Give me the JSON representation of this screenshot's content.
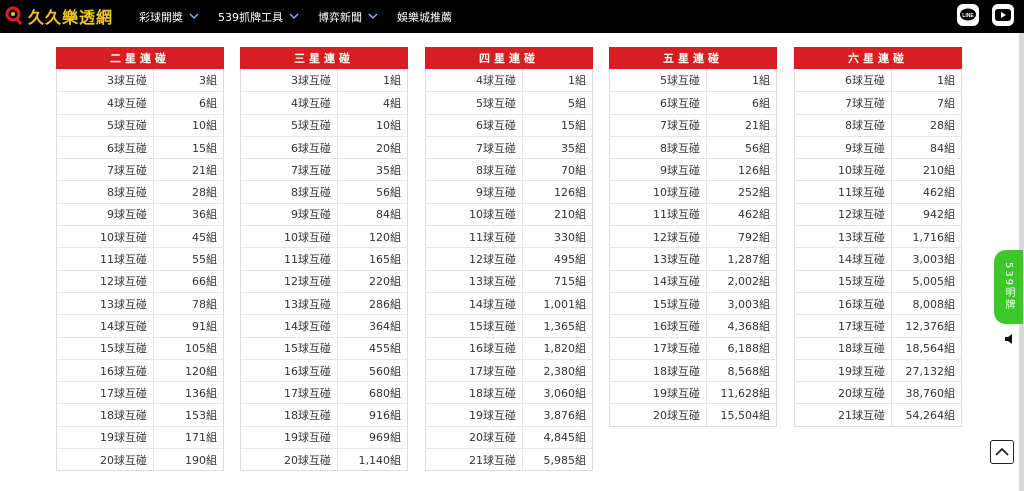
{
  "brand": {
    "name": "久久樂透網",
    "accent": "#f0c419"
  },
  "nav": [
    {
      "label": "彩球開獎",
      "has_dropdown": true
    },
    {
      "label": "539抓牌工具",
      "has_dropdown": true
    },
    {
      "label": "博弈新聞",
      "has_dropdown": true
    },
    {
      "label": "娛樂城推薦",
      "has_dropdown": false
    }
  ],
  "top_icons": [
    "line-icon",
    "youtube-icon"
  ],
  "tables": [
    {
      "title": "二星連碰",
      "rows": [
        [
          "3球互碰",
          "3組"
        ],
        [
          "4球互碰",
          "6組"
        ],
        [
          "5球互碰",
          "10組"
        ],
        [
          "6球互碰",
          "15組"
        ],
        [
          "7球互碰",
          "21組"
        ],
        [
          "8球互碰",
          "28組"
        ],
        [
          "9球互碰",
          "36組"
        ],
        [
          "10球互碰",
          "45組"
        ],
        [
          "11球互碰",
          "55組"
        ],
        [
          "12球互碰",
          "66組"
        ],
        [
          "13球互碰",
          "78組"
        ],
        [
          "14球互碰",
          "91組"
        ],
        [
          "15球互碰",
          "105組"
        ],
        [
          "16球互碰",
          "120組"
        ],
        [
          "17球互碰",
          "136組"
        ],
        [
          "18球互碰",
          "153組"
        ],
        [
          "19球互碰",
          "171組"
        ],
        [
          "20球互碰",
          "190組"
        ]
      ]
    },
    {
      "title": "三星連碰",
      "rows": [
        [
          "3球互碰",
          "1組"
        ],
        [
          "4球互碰",
          "4組"
        ],
        [
          "5球互碰",
          "10組"
        ],
        [
          "6球互碰",
          "20組"
        ],
        [
          "7球互碰",
          "35組"
        ],
        [
          "8球互碰",
          "56組"
        ],
        [
          "9球互碰",
          "84組"
        ],
        [
          "10球互碰",
          "120組"
        ],
        [
          "11球互碰",
          "165組"
        ],
        [
          "12球互碰",
          "220組"
        ],
        [
          "13球互碰",
          "286組"
        ],
        [
          "14球互碰",
          "364組"
        ],
        [
          "15球互碰",
          "455組"
        ],
        [
          "16球互碰",
          "560組"
        ],
        [
          "17球互碰",
          "680組"
        ],
        [
          "18球互碰",
          "916組"
        ],
        [
          "19球互碰",
          "969組"
        ],
        [
          "20球互碰",
          "1,140組"
        ]
      ]
    },
    {
      "title": "四星連碰",
      "rows": [
        [
          "4球互碰",
          "1組"
        ],
        [
          "5球互碰",
          "5組"
        ],
        [
          "6球互碰",
          "15組"
        ],
        [
          "7球互碰",
          "35組"
        ],
        [
          "8球互碰",
          "70組"
        ],
        [
          "9球互碰",
          "126組"
        ],
        [
          "10球互碰",
          "210組"
        ],
        [
          "11球互碰",
          "330組"
        ],
        [
          "12球互碰",
          "495組"
        ],
        [
          "13球互碰",
          "715組"
        ],
        [
          "14球互碰",
          "1,001組"
        ],
        [
          "15球互碰",
          "1,365組"
        ],
        [
          "16球互碰",
          "1,820組"
        ],
        [
          "17球互碰",
          "2,380組"
        ],
        [
          "18球互碰",
          "3,060組"
        ],
        [
          "19球互碰",
          "3,876組"
        ],
        [
          "20球互碰",
          "4,845組"
        ],
        [
          "21球互碰",
          "5,985組"
        ]
      ]
    },
    {
      "title": "五星連碰",
      "rows": [
        [
          "5球互碰",
          "1組"
        ],
        [
          "6球互碰",
          "6組"
        ],
        [
          "7球互碰",
          "21組"
        ],
        [
          "8球互碰",
          "56組"
        ],
        [
          "9球互碰",
          "126組"
        ],
        [
          "10球互碰",
          "252組"
        ],
        [
          "11球互碰",
          "462組"
        ],
        [
          "12球互碰",
          "792組"
        ],
        [
          "13球互碰",
          "1,287組"
        ],
        [
          "14球互碰",
          "2,002組"
        ],
        [
          "15球互碰",
          "3,003組"
        ],
        [
          "16球互碰",
          "4,368組"
        ],
        [
          "17球互碰",
          "6,188組"
        ],
        [
          "18球互碰",
          "8,568組"
        ],
        [
          "19球互碰",
          "11,628組"
        ],
        [
          "20球互碰",
          "15,504組"
        ]
      ]
    },
    {
      "title": "六星連碰",
      "rows": [
        [
          "6球互碰",
          "1組"
        ],
        [
          "7球互碰",
          "7組"
        ],
        [
          "8球互碰",
          "28組"
        ],
        [
          "9球互碰",
          "84組"
        ],
        [
          "10球互碰",
          "210組"
        ],
        [
          "11球互碰",
          "462組"
        ],
        [
          "12球互碰",
          "942組"
        ],
        [
          "13球互碰",
          "1,716組"
        ],
        [
          "14球互碰",
          "3,003組"
        ],
        [
          "15球互碰",
          "5,005組"
        ],
        [
          "16球互碰",
          "8,008組"
        ],
        [
          "17球互碰",
          "12,376組"
        ],
        [
          "18球互碰",
          "18,564組"
        ],
        [
          "19球互碰",
          "27,132組"
        ],
        [
          "20球互碰",
          "38,760組"
        ],
        [
          "21球互碰",
          "54,264組"
        ]
      ]
    }
  ],
  "side_tab": {
    "label": "539明牌"
  },
  "colors": {
    "header_red": "#d71e23",
    "tab_green": "#3ec72a"
  }
}
